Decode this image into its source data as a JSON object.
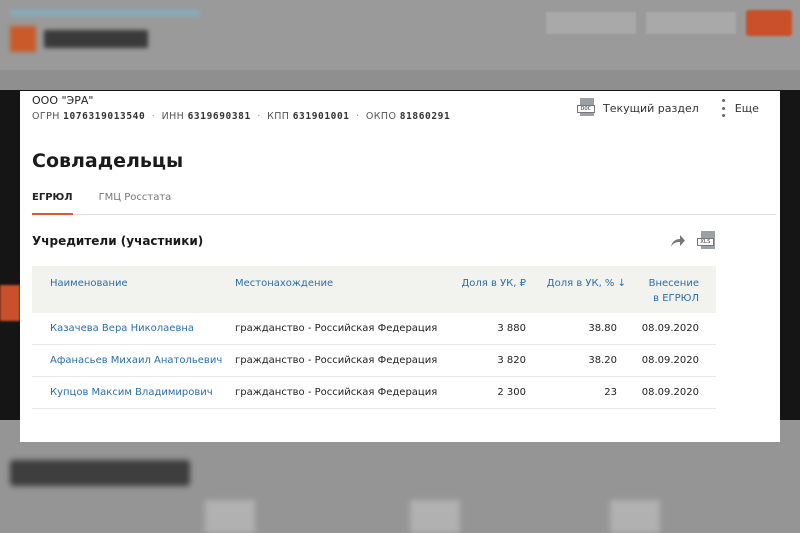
{
  "company": {
    "name": "ООО \"ЭРА\"",
    "ids": [
      {
        "label": "ОГРН",
        "value": "1076319013540"
      },
      {
        "label": "ИНН",
        "value": "6319690381"
      },
      {
        "label": "КПП",
        "value": "631901001"
      },
      {
        "label": "ОКПО",
        "value": "81860291"
      }
    ],
    "separator": "·"
  },
  "actions": {
    "current_section_label": "Текущий раздел",
    "current_section_icon": "doc-icon",
    "doc_tag": "DOC",
    "more_label": "Еще",
    "more_icon": "more-vertical-icon"
  },
  "page": {
    "title": "Совладельцы",
    "tabs": [
      {
        "label": "ЕГРЮЛ",
        "active": true
      },
      {
        "label": "ГМЦ Росстата",
        "active": false
      }
    ],
    "section_title": "Учредители (участники)",
    "share_icon": "share-arrow-icon",
    "xls_icon": "xls-icon",
    "xls_tag": "XLS"
  },
  "table": {
    "headers": {
      "name": "Наименование",
      "location": "Местонахождение",
      "share_rub": "Доля в УК, ₽",
      "share_pct": "Доля в УК, % ↓",
      "date_line1": "Внесение",
      "date_line2": "в ЕГРЮЛ"
    },
    "rows": [
      {
        "name": "Казачева Вера Николаевна",
        "location": "гражданство - Российская Федерация",
        "share_rub": "3 880",
        "share_pct": "38.80",
        "date": "08.09.2020"
      },
      {
        "name": "Афанасьев Михаил Анатольевич",
        "location": "гражданство - Российская Федерация",
        "share_rub": "3 820",
        "share_pct": "38.20",
        "date": "08.09.2020"
      },
      {
        "name": "Купцов Максим Владимирович",
        "location": "гражданство - Российская Федерация",
        "share_rub": "2 300",
        "share_pct": "23",
        "date": "08.09.2020"
      }
    ]
  },
  "colors": {
    "accent": "#e0582b",
    "link": "#2a6fa8",
    "header_bg": "#f2f2ee"
  }
}
